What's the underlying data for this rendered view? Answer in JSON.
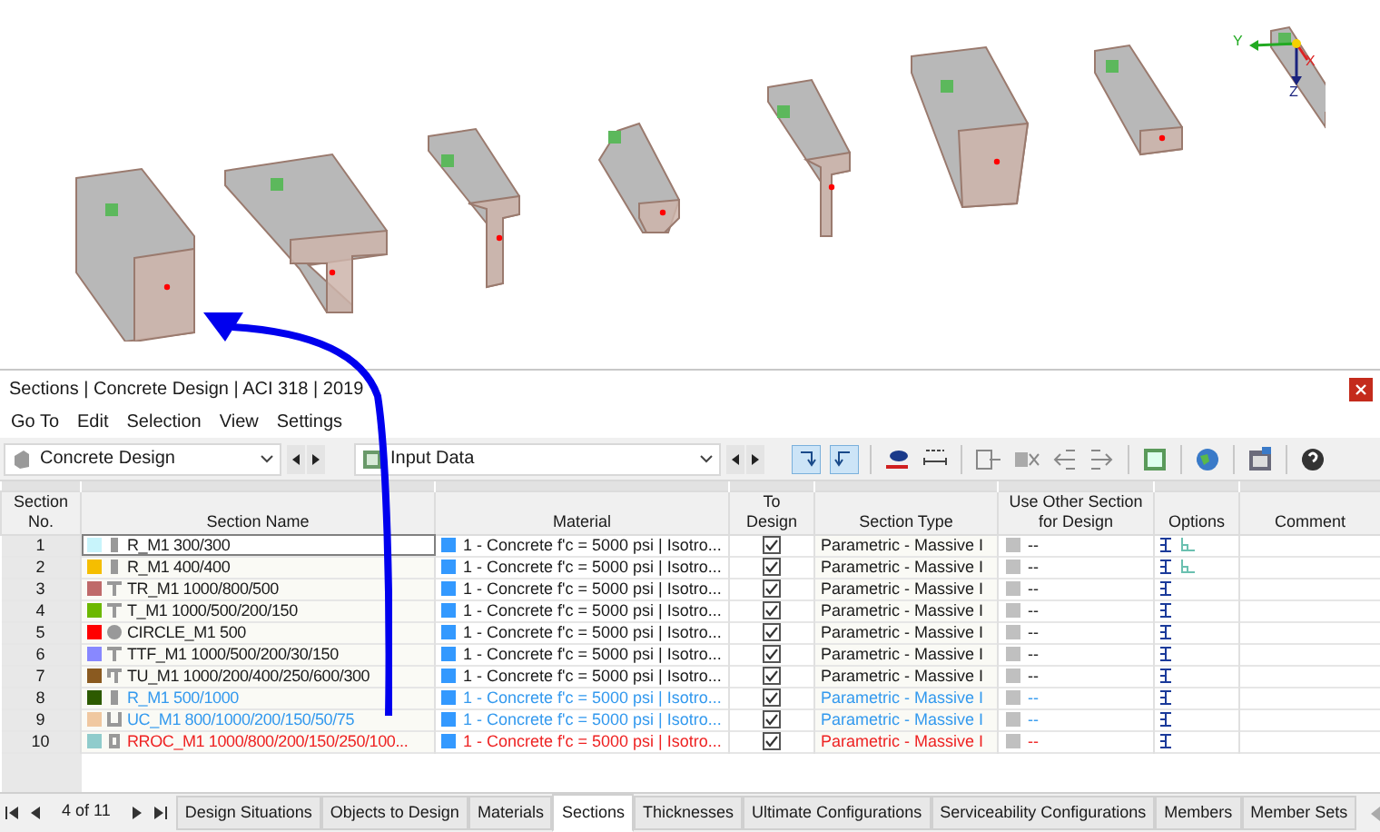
{
  "viewport": {
    "axes": {
      "y": "Y",
      "x": "X",
      "z": "Z"
    }
  },
  "panel": {
    "title": "Sections | Concrete Design | ACI 318 | 2019"
  },
  "menu": [
    "Go To",
    "Edit",
    "Selection",
    "View",
    "Settings"
  ],
  "toolbar": {
    "module": "Concrete Design",
    "view": "Input Data"
  },
  "table": {
    "columns": [
      "Section No.",
      "Section Name",
      "Material",
      "To Design",
      "Section Type",
      "Use Other Section for Design",
      "Options",
      "Comment"
    ],
    "rows": [
      {
        "no": "1",
        "name": "R_M1 300/300",
        "color": "#c8f4fb",
        "kind": "rect",
        "material": "1 - Concrete f'c = 5000 psi | Isotro...",
        "to_design": true,
        "type": "Parametric - Massive I",
        "other": "--",
        "extra_option": true,
        "modified": false,
        "error": false,
        "selected": true
      },
      {
        "no": "2",
        "name": "R_M1 400/400",
        "color": "#f5be00",
        "kind": "rect",
        "material": "1 - Concrete f'c = 5000 psi | Isotro...",
        "to_design": true,
        "type": "Parametric - Massive I",
        "other": "--",
        "extra_option": true,
        "modified": false,
        "error": false,
        "selected": false
      },
      {
        "no": "3",
        "name": "TR_M1 1000/800/500",
        "color": "#bf6a6a",
        "kind": "t",
        "material": "1 - Concrete f'c = 5000 psi | Isotro...",
        "to_design": true,
        "type": "Parametric - Massive I",
        "other": "--",
        "extra_option": false,
        "modified": false,
        "error": false,
        "selected": false
      },
      {
        "no": "4",
        "name": "T_M1 1000/500/200/150",
        "color": "#6cb800",
        "kind": "t",
        "material": "1 - Concrete f'c = 5000 psi | Isotro...",
        "to_design": true,
        "type": "Parametric - Massive I",
        "other": "--",
        "extra_option": false,
        "modified": false,
        "error": false,
        "selected": false
      },
      {
        "no": "5",
        "name": "CIRCLE_M1 500",
        "color": "#ff0000",
        "kind": "circle",
        "material": "1 - Concrete f'c = 5000 psi | Isotro...",
        "to_design": true,
        "type": "Parametric - Massive I",
        "other": "--",
        "extra_option": false,
        "modified": false,
        "error": false,
        "selected": false
      },
      {
        "no": "6",
        "name": "TTF_M1 1000/500/200/30/150",
        "color": "#8888ff",
        "kind": "t",
        "material": "1 - Concrete f'c = 5000 psi | Isotro...",
        "to_design": true,
        "type": "Parametric - Massive I",
        "other": "--",
        "extra_option": false,
        "modified": false,
        "error": false,
        "selected": false
      },
      {
        "no": "7",
        "name": "TU_M1 1000/200/400/250/600/300",
        "color": "#8a5a20",
        "kind": "tu",
        "material": "1 - Concrete f'c = 5000 psi | Isotro...",
        "to_design": true,
        "type": "Parametric - Massive I",
        "other": "--",
        "extra_option": false,
        "modified": false,
        "error": false,
        "selected": false
      },
      {
        "no": "8",
        "name": "R_M1 500/1000",
        "color": "#2d5a00",
        "kind": "rect",
        "material": "1 - Concrete f'c = 5000 psi | Isotro...",
        "to_design": true,
        "type": "Parametric - Massive I",
        "other": "--",
        "extra_option": false,
        "modified": true,
        "error": false,
        "selected": false
      },
      {
        "no": "9",
        "name": "UC_M1 800/1000/200/150/50/75",
        "color": "#f0c8a0",
        "kind": "u",
        "material": "1 - Concrete f'c = 5000 psi | Isotro...",
        "to_design": true,
        "type": "Parametric - Massive I",
        "other": "--",
        "extra_option": false,
        "modified": true,
        "error": false,
        "selected": false
      },
      {
        "no": "10",
        "name": "RROC_M1 1000/800/200/150/250/100...",
        "color": "#90cccc",
        "kind": "hollow",
        "material": "1 - Concrete f'c = 5000 psi | Isotro...",
        "to_design": true,
        "type": "Parametric - Massive I",
        "other": "--",
        "extra_option": false,
        "modified": false,
        "error": true,
        "selected": false
      }
    ]
  },
  "pager": {
    "text": "4 of 11"
  },
  "tabs": [
    {
      "label": "Design Situations",
      "selected": false
    },
    {
      "label": "Objects to Design",
      "selected": false
    },
    {
      "label": "Materials",
      "selected": false
    },
    {
      "label": "Sections",
      "selected": true
    },
    {
      "label": "Thicknesses",
      "selected": false
    },
    {
      "label": "Ultimate Configurations",
      "selected": false
    },
    {
      "label": "Serviceability Configurations",
      "selected": false
    },
    {
      "label": "Members",
      "selected": false
    },
    {
      "label": "Member Sets",
      "selected": false
    }
  ]
}
